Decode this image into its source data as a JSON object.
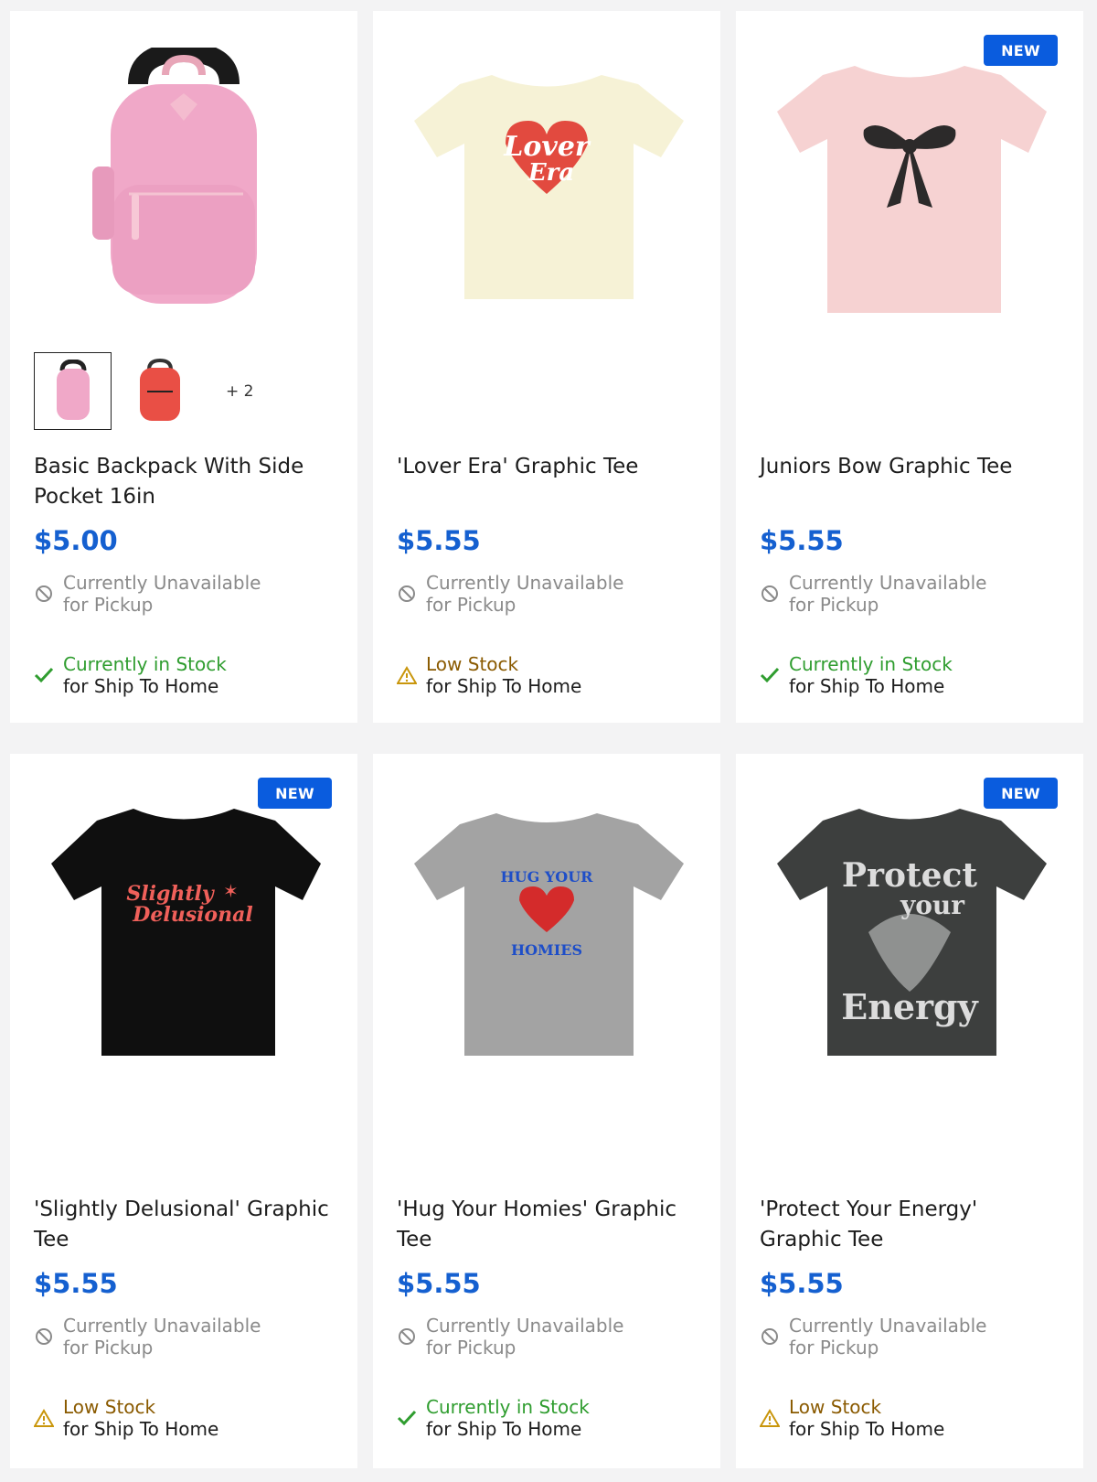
{
  "colors": {
    "accent": "#0a5cde",
    "price": "#1560d0",
    "in_stock": "#2f9d2f",
    "low_stock": "#8a5a00",
    "unavailable": "#8a8a8a"
  },
  "products": [
    {
      "title": "Basic Backpack With Side Pocket 16in",
      "price": "$5.00",
      "badge": "",
      "thumbs_more": "+ 2",
      "pickup_line1": "Currently Unavailable",
      "pickup_line2": "for Pickup",
      "ship_line1": "Currently in Stock",
      "ship_line2": "for Ship To Home",
      "ship_status": "in-stock"
    },
    {
      "title": "'Lover Era' Graphic Tee",
      "price": "$5.55",
      "badge": "",
      "pickup_line1": "Currently Unavailable",
      "pickup_line2": "for Pickup",
      "ship_line1": "Low Stock",
      "ship_line2": "for Ship To Home",
      "ship_status": "low-stock",
      "graphic_text": [
        "Lover",
        "Era"
      ]
    },
    {
      "title": "Juniors Bow Graphic Tee",
      "price": "$5.55",
      "badge": "NEW",
      "pickup_line1": "Currently Unavailable",
      "pickup_line2": "for Pickup",
      "ship_line1": "Currently in Stock",
      "ship_line2": "for Ship To Home",
      "ship_status": "in-stock"
    },
    {
      "title": "'Slightly Delusional' Graphic Tee",
      "price": "$5.55",
      "badge": "NEW",
      "pickup_line1": "Currently Unavailable",
      "pickup_line2": "for Pickup",
      "ship_line1": "Low Stock",
      "ship_line2": "for Ship To Home",
      "ship_status": "low-stock",
      "graphic_text": [
        "Slightly",
        "Delusional"
      ]
    },
    {
      "title": "'Hug Your Homies' Graphic Tee",
      "price": "$5.55",
      "badge": "",
      "pickup_line1": "Currently Unavailable",
      "pickup_line2": "for Pickup",
      "ship_line1": "Currently in Stock",
      "ship_line2": "for Ship To Home",
      "ship_status": "in-stock",
      "graphic_text": [
        "HUG YOUR",
        "HOMIES"
      ]
    },
    {
      "title": "'Protect Your Energy' Graphic Tee",
      "price": "$5.55",
      "badge": "NEW",
      "pickup_line1": "Currently Unavailable",
      "pickup_line2": "for Pickup",
      "ship_line1": "Low Stock",
      "ship_line2": "for Ship To Home",
      "ship_status": "low-stock",
      "graphic_text": [
        "Protect",
        "your",
        "Energy"
      ]
    }
  ]
}
